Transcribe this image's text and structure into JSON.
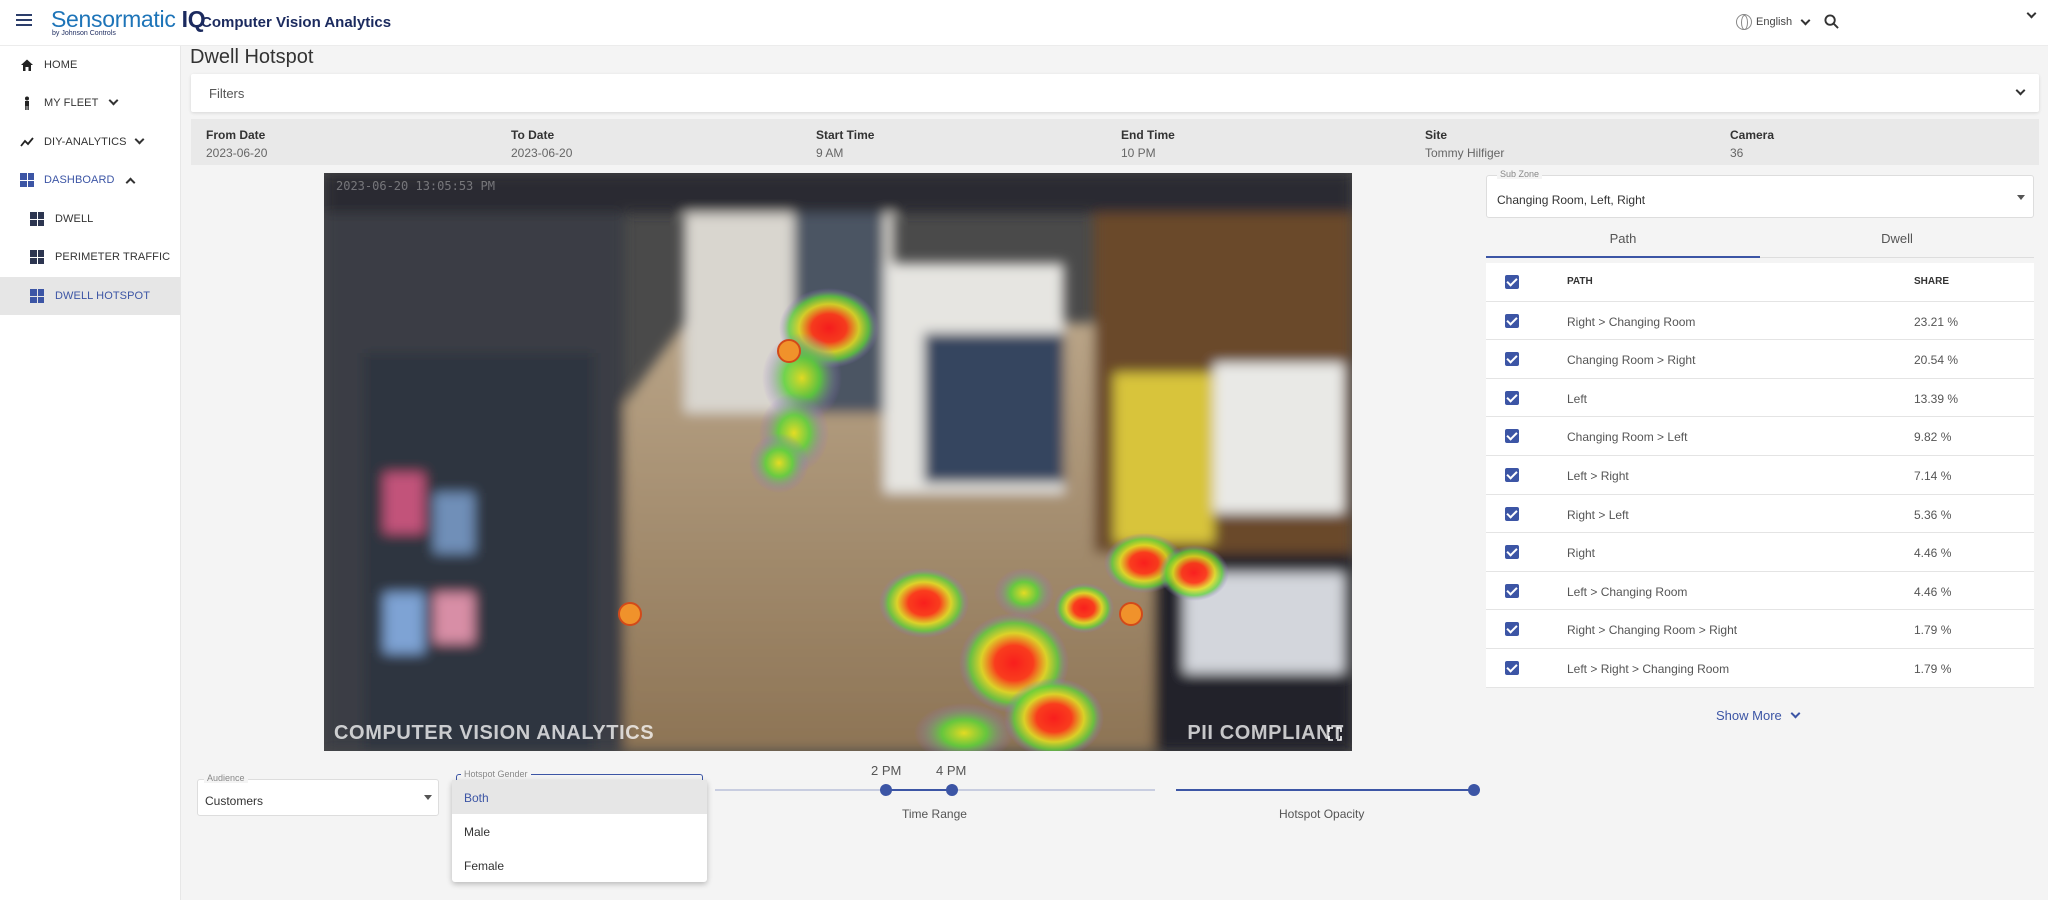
{
  "header": {
    "logo_main": "Sensormatic",
    "logo_iq": "IQ",
    "logo_sub": "by Johnson Controls",
    "app_title": "Computer Vision Analytics",
    "language": "English"
  },
  "sidebar": {
    "items": [
      {
        "label": "HOME",
        "icon": "home-icon"
      },
      {
        "label": "MY FLEET",
        "icon": "person-icon"
      },
      {
        "label": "DIY-ANALYTICS",
        "icon": "analytics-icon"
      },
      {
        "label": "DASHBOARD",
        "icon": "dashboard-icon"
      },
      {
        "label": "DWELL",
        "icon": "dashboard-icon"
      },
      {
        "label": "PERIMETER TRAFFIC",
        "icon": "dashboard-icon"
      },
      {
        "label": "DWELL HOTSPOT",
        "icon": "dashboard-icon"
      }
    ],
    "active": "DWELL HOTSPOT"
  },
  "page": {
    "title": "Dwell Hotspot",
    "filters_label": "Filters"
  },
  "info": {
    "from_date_label": "From Date",
    "from_date": "2023-06-20",
    "to_date_label": "To Date",
    "to_date": "2023-06-20",
    "start_time_label": "Start Time",
    "start_time": "9 AM",
    "end_time_label": "End Time",
    "end_time": "10 PM",
    "site_label": "Site",
    "site": "Tommy Hilfiger",
    "camera_label": "Camera",
    "camera": "36"
  },
  "camera_view": {
    "timestamp": "2023-06-20 13:05:53 PM",
    "overlay_left": "COMPUTER VISION ANALYTICS",
    "overlay_right": "PII COMPLIANT"
  },
  "subzone": {
    "label": "Sub Zone",
    "value": "Changing Room, Left, Right"
  },
  "tabs": {
    "path": "Path",
    "dwell": "Dwell",
    "active": "Path"
  },
  "path_table": {
    "header_path": "PATH",
    "header_share": "SHARE",
    "rows": [
      {
        "path": "Right > Changing Room",
        "share": "23.21 %"
      },
      {
        "path": "Changing Room > Right",
        "share": "20.54 %"
      },
      {
        "path": "Left",
        "share": "13.39 %"
      },
      {
        "path": "Changing Room > Left",
        "share": "9.82 %"
      },
      {
        "path": "Left > Right",
        "share": "7.14 %"
      },
      {
        "path": "Right > Left",
        "share": "5.36 %"
      },
      {
        "path": "Right",
        "share": "4.46 %"
      },
      {
        "path": "Left > Changing Room",
        "share": "4.46 %"
      },
      {
        "path": "Right > Changing Room > Right",
        "share": "1.79 %"
      },
      {
        "path": "Left > Right > Changing Room",
        "share": "1.79 %"
      }
    ],
    "show_more": "Show More"
  },
  "controls": {
    "audience_label": "Audience",
    "audience_value": "Customers",
    "gender_label": "Hotspot Gender",
    "gender_options": [
      "Both",
      "Male",
      "Female"
    ],
    "gender_selected": "Both",
    "time_range_label": "Time Range",
    "time_start": "2 PM",
    "time_end": "4 PM",
    "opacity_label": "Hotspot Opacity",
    "opacity_value": 1.0
  },
  "colors": {
    "accent": "#3c55a5",
    "brand_blue": "#1d74b8",
    "brand_navy": "#1b2a5e"
  }
}
